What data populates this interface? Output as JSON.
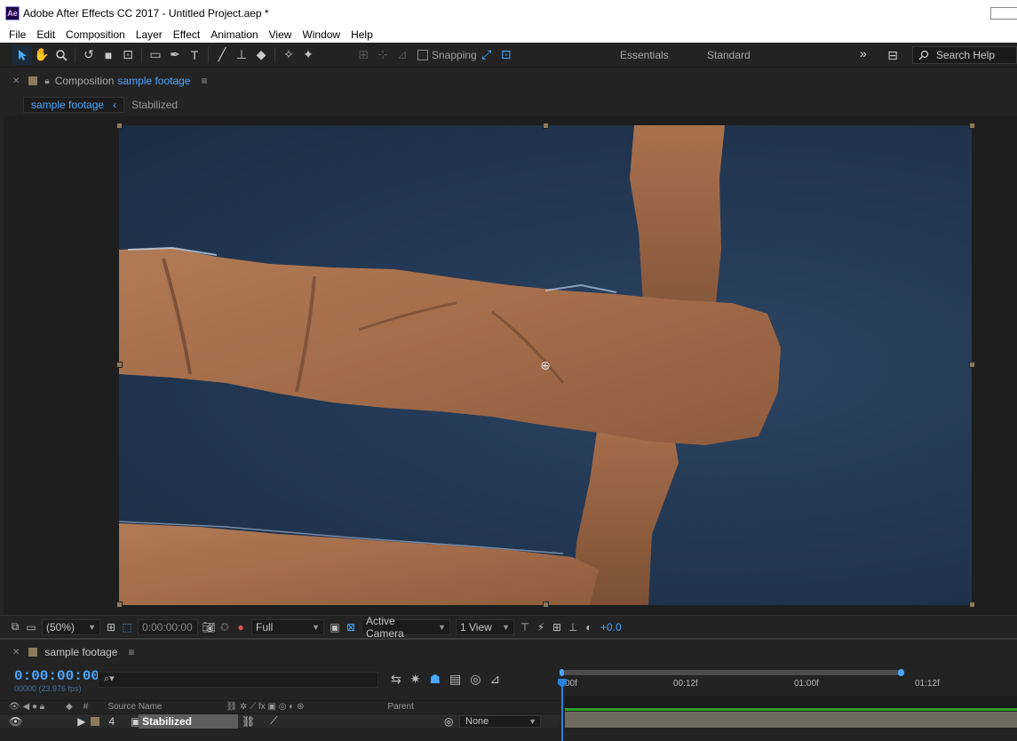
{
  "window": {
    "logo": "Ae",
    "title": "Adobe After Effects CC 2017 - Untitled Project.aep *"
  },
  "menu": [
    "File",
    "Edit",
    "Composition",
    "Layer",
    "Effect",
    "Animation",
    "View",
    "Window",
    "Help"
  ],
  "toolbar": {
    "snapping_label": "Snapping",
    "workspaces": [
      "Essentials",
      "Standard"
    ],
    "overflow": "»",
    "search_placeholder": "Search Help"
  },
  "composition_panel": {
    "prefix": "Composition",
    "name": "sample footage",
    "tabs": [
      "sample footage",
      "Stabilized"
    ],
    "tab_separator": "‹"
  },
  "viewer_controls": {
    "zoom": "(50%)",
    "timecode": "0:00:00:00",
    "resolution": "Full",
    "camera": "Active Camera",
    "views": "1 View",
    "exposure": "+0.0"
  },
  "timeline": {
    "tab_name": "sample footage",
    "current_time": "0:00:00:00",
    "fps_label": "00000 (23.976 fps)",
    "search_placeholder": "",
    "ruler_labels": [
      "00f",
      "00:12f",
      "01:00f",
      "01:12f"
    ],
    "columns": {
      "number": "#",
      "source_name": "Source Name",
      "switches": "",
      "parent": "Parent"
    },
    "layers": [
      {
        "index": "4",
        "name": "Stabilized",
        "parent": "None"
      }
    ]
  },
  "colors": {
    "accent_blue": "#4aa7ff",
    "label_tan": "#8c7a5a",
    "panel_bg": "#232323"
  }
}
